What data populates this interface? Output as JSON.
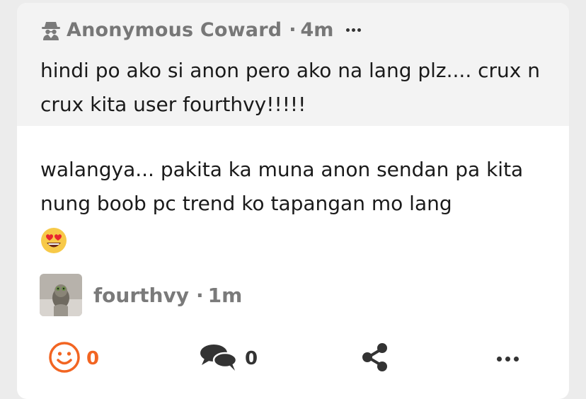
{
  "quote": {
    "author": "Anonymous Coward",
    "separator": "·",
    "time": "4m",
    "text": "hindi po ako si anon pero ako na lang plz.... crux n crux kita user fourthvy!!!!!"
  },
  "reply": {
    "text": "walangya... pakita ka muna anon sendan pa kita nung boob pc trend ko tapangan mo lang",
    "emoji": "heart-eyes-emoji"
  },
  "author": {
    "name": "fourthvy",
    "separator": "·",
    "time": "1m"
  },
  "actions": {
    "react_count": "0",
    "comment_count": "0"
  },
  "colors": {
    "accent": "#f26522",
    "quote_bg": "#f3f3f3",
    "muted_text": "#777777"
  },
  "icons": [
    "spy-icon",
    "more-icon",
    "smiley-icon",
    "comments-icon",
    "share-icon"
  ]
}
